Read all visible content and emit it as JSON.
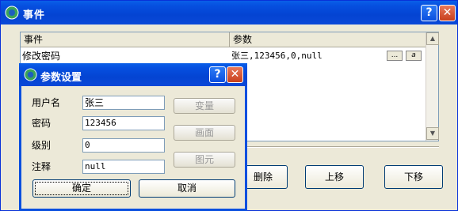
{
  "main_window": {
    "title": "事件",
    "help_label": "?",
    "close_label": "✕"
  },
  "grid": {
    "columns": [
      "事件",
      "参数"
    ],
    "rows": [
      {
        "event": "修改密码",
        "params": "张三,123456,0,null"
      }
    ],
    "ellipsis_label": "...",
    "alt_label": "a"
  },
  "main_buttons": {
    "delete": "删除",
    "move_up": "上移",
    "move_down": "下移"
  },
  "dialog": {
    "title": "参数设置",
    "help_label": "?",
    "close_label": "✕",
    "fields": {
      "username": {
        "label": "用户名",
        "value": "张三"
      },
      "password": {
        "label": "密码",
        "value": "123456"
      },
      "level": {
        "label": "级别",
        "value": "0"
      },
      "comment": {
        "label": "注释",
        "value": "null"
      }
    },
    "side_buttons": {
      "variable": "变量",
      "screen": "画面",
      "element": "图元"
    },
    "ok": "确定",
    "cancel": "取消"
  }
}
